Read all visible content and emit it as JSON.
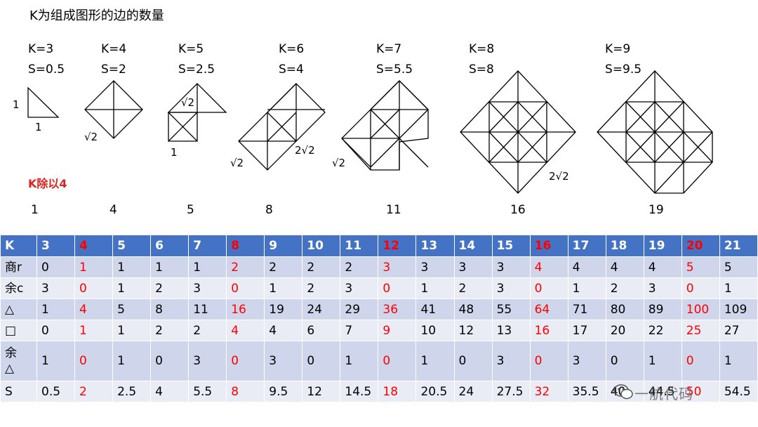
{
  "heading": "K为组成图形的边的数量",
  "figures": [
    {
      "k": "K=3",
      "s": "S=0.5"
    },
    {
      "k": "K=4",
      "s": "S=2"
    },
    {
      "k": "K=5",
      "s": "S=2.5"
    },
    {
      "k": "K=6",
      "s": "S=4"
    },
    {
      "k": "K=7",
      "s": "S=5.5"
    },
    {
      "k": "K=8",
      "s": "S=8"
    },
    {
      "k": "K=9",
      "s": "S=9.5"
    }
  ],
  "notes": {
    "one_left": "1",
    "one_bottom": "1",
    "sqrt2_a": "√2",
    "sqrt2_b": "√2",
    "one_c": "1",
    "sqrt2_c": "√2",
    "two_sqrt2_c": "2√2",
    "sqrt2_d": "√2",
    "two_sqrt2_d": "2√2"
  },
  "red_title": "K除以4",
  "quotients": [
    "1",
    "4",
    "5",
    "8",
    "11",
    "16",
    "19"
  ],
  "table": {
    "header": [
      "K",
      "3",
      "4",
      "5",
      "6",
      "7",
      "8",
      "9",
      "10",
      "11",
      "12",
      "13",
      "14",
      "15",
      "16",
      "17",
      "18",
      "19",
      "20",
      "21"
    ],
    "highlight_cols": [
      2,
      6,
      10,
      14,
      18
    ],
    "rows": [
      {
        "label": "商r",
        "cells": [
          "0",
          "1",
          "1",
          "1",
          "1",
          "2",
          "2",
          "2",
          "2",
          "3",
          "3",
          "3",
          "3",
          "4",
          "4",
          "4",
          "4",
          "5",
          "5"
        ]
      },
      {
        "label": "余c",
        "cells": [
          "3",
          "0",
          "1",
          "2",
          "3",
          "0",
          "1",
          "2",
          "3",
          "0",
          "1",
          "2",
          "3",
          "0",
          "1",
          "2",
          "3",
          "0",
          "1"
        ]
      },
      {
        "label": "△",
        "cells": [
          "1",
          "4",
          "5",
          "8",
          "11",
          "16",
          "19",
          "24",
          "29",
          "36",
          "41",
          "48",
          "55",
          "64",
          "71",
          "80",
          "89",
          "100",
          "109"
        ]
      },
      {
        "label": "□",
        "cells": [
          "0",
          "1",
          "1",
          "2",
          "2",
          "4",
          "4",
          "6",
          "7",
          "9",
          "10",
          "12",
          "13",
          "16",
          "17",
          "20",
          "22",
          "25",
          "27"
        ]
      },
      {
        "label": "余△",
        "cells": [
          "1",
          "0",
          "1",
          "0",
          "3",
          "0",
          "3",
          "0",
          "1",
          "0",
          "1",
          "0",
          "3",
          "0",
          "3",
          "0",
          "1",
          "0",
          "1"
        ]
      },
      {
        "label": "S",
        "cells": [
          "0.5",
          "2",
          "2.5",
          "4",
          "5.5",
          "8",
          "9.5",
          "12",
          "14.5",
          "18",
          "20.5",
          "24",
          "27.5",
          "32",
          "35.5",
          "40",
          "44.5",
          "50",
          "54.5"
        ]
      }
    ]
  },
  "watermark": "一航代码",
  "colors": {
    "header_bg": "#4472c4",
    "row_odd": "#cfd5ea",
    "row_even": "#e9ebf5",
    "highlight": "#ff0000"
  }
}
